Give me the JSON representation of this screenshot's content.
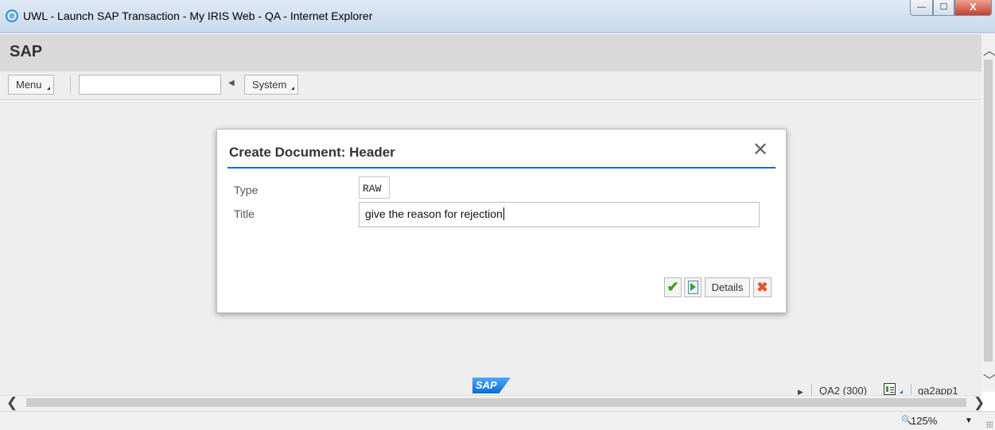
{
  "window": {
    "title": "UWL - Launch SAP Transaction - My IRIS Web - QA - Internet Explorer",
    "minimize_glyph": "—",
    "maximize_glyph": "☐",
    "close_glyph": "X"
  },
  "sap": {
    "brand": "SAP",
    "toolbar": {
      "menu_label": "Menu",
      "command_field_value": "",
      "system_label": "System"
    },
    "logo_text": "SAP"
  },
  "dialog": {
    "title": "Create Document: Header",
    "close_glyph": "✕",
    "fields": {
      "type_label": "Type",
      "type_value": "RAW",
      "title_label": "Title",
      "title_value": "give the reason for rejection"
    },
    "buttons": {
      "confirm_glyph": "✔",
      "details_label": "Details",
      "cancel_glyph": "✖"
    }
  },
  "statusbar": {
    "system": "QA2 (300)",
    "server": "qa2app1"
  },
  "ie": {
    "zoom": "125%"
  },
  "colors": {
    "accent": "#0a6ed1",
    "confirm": "#3a9d23",
    "cancel": "#e4532a"
  }
}
